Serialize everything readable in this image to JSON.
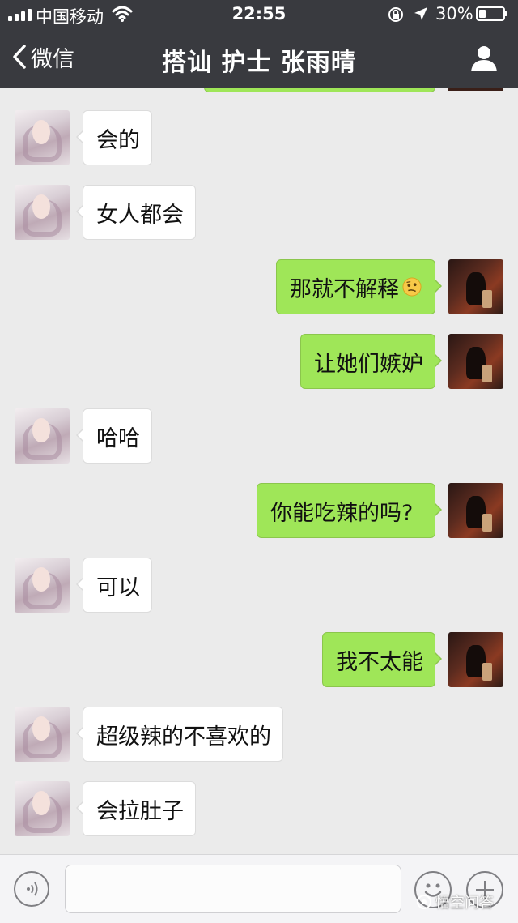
{
  "status_bar": {
    "carrier": "中国移动",
    "time": "22:55",
    "battery_percent": "30%",
    "battery_level": 0.3,
    "icons": [
      "signal-icon",
      "wifi-icon",
      "orientation-lock-icon",
      "location-arrow-icon",
      "battery-icon"
    ]
  },
  "nav": {
    "back_label": "微信",
    "title": "搭讪 护士 张雨晴",
    "back_icon": "chevron-left-icon",
    "profile_icon": "person-icon"
  },
  "messages": [
    {
      "side": "in",
      "text": "会的"
    },
    {
      "side": "in",
      "text": "女人都会"
    },
    {
      "side": "out",
      "text": "那就不解释",
      "emoji": "thinking-face-emoji"
    },
    {
      "side": "out",
      "text": "让她们嫉妒"
    },
    {
      "side": "in",
      "text": "哈哈"
    },
    {
      "side": "out",
      "text": "你能吃辣的吗?"
    },
    {
      "side": "in",
      "text": "可以"
    },
    {
      "side": "out",
      "text": "我不太能"
    },
    {
      "side": "in",
      "text": "超级辣的不喜欢的"
    },
    {
      "side": "in",
      "text": "会拉肚子"
    }
  ],
  "input_bar": {
    "voice_icon": "voice-icon",
    "emoji_icon": "emoji-icon",
    "plus_icon": "plus-icon",
    "text_value": ""
  },
  "watermark": {
    "text": "悟空问答"
  },
  "colors": {
    "nav_bg": "#393a3f",
    "chat_bg": "#ebebeb",
    "outgoing_bubble": "#9fe658",
    "incoming_bubble": "#ffffff"
  }
}
